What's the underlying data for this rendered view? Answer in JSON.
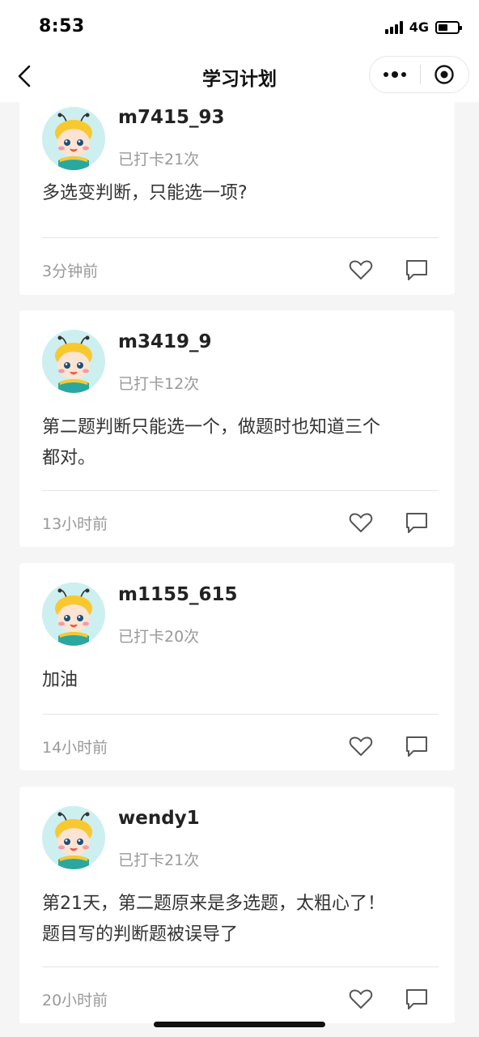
{
  "status_bar": {
    "time": "8:53",
    "network": "4G"
  },
  "nav": {
    "title": "学习计划",
    "back_icon": "chevron-left-icon",
    "more_icon": "more-dots-icon",
    "close_icon": "target-circle-icon"
  },
  "colors": {
    "avatar_bg": "#cdeff0",
    "secondary_text": "#999999",
    "divider": "#e5e5e5",
    "background": "#f5f5f5"
  },
  "posts": [
    {
      "username": "m7415_93",
      "checkin": "已打卡21次",
      "content": "多选变判断，只能选一项?",
      "time": "3分钟前",
      "like_icon": "heart-icon",
      "comment_icon": "comment-icon"
    },
    {
      "username": "m3419_9",
      "checkin": "已打卡12次",
      "content_lines": [
        "第二题判断只能选一个，做题时也知道三个",
        "都对。"
      ],
      "time": "13小时前",
      "like_icon": "heart-icon",
      "comment_icon": "comment-icon"
    },
    {
      "username": "m1155_615",
      "checkin": "已打卡20次",
      "content": "加油",
      "time": "14小时前",
      "like_icon": "heart-icon",
      "comment_icon": "comment-icon"
    },
    {
      "username": "wendy1",
      "checkin": "已打卡21次",
      "content_lines": [
        "第21天，第二题原来是多选题，太粗心了！",
        "题目写的判断题被误导了"
      ],
      "time": "20小时前",
      "like_icon": "heart-icon",
      "comment_icon": "comment-icon"
    }
  ]
}
